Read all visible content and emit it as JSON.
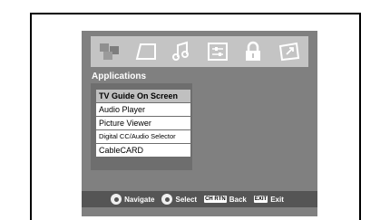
{
  "tabs": [
    {
      "icon": "picture-tab-icon"
    },
    {
      "icon": "screen-tab-icon"
    },
    {
      "icon": "audio-tab-icon"
    },
    {
      "icon": "setup-tab-icon"
    },
    {
      "icon": "lock-tab-icon"
    },
    {
      "icon": "applications-tab-icon"
    }
  ],
  "menu": {
    "title": "Applications",
    "items": [
      {
        "label": "TV Guide On Screen",
        "selected": true
      },
      {
        "label": "Audio Player"
      },
      {
        "label": "Picture Viewer"
      },
      {
        "label": "Digital CC/Audio Selector"
      },
      {
        "label": "CableCARD"
      }
    ]
  },
  "footer": {
    "navigate": "Navigate",
    "select": "Select",
    "back_key": "CH RTN",
    "back": "Back",
    "exit_key": "EXIT",
    "exit": "Exit"
  },
  "colors": {
    "screen_bg": "#808080",
    "icon_bar": "#c4c4c4",
    "highlight": "#c0c0c0",
    "footer_bg": "#555555"
  }
}
